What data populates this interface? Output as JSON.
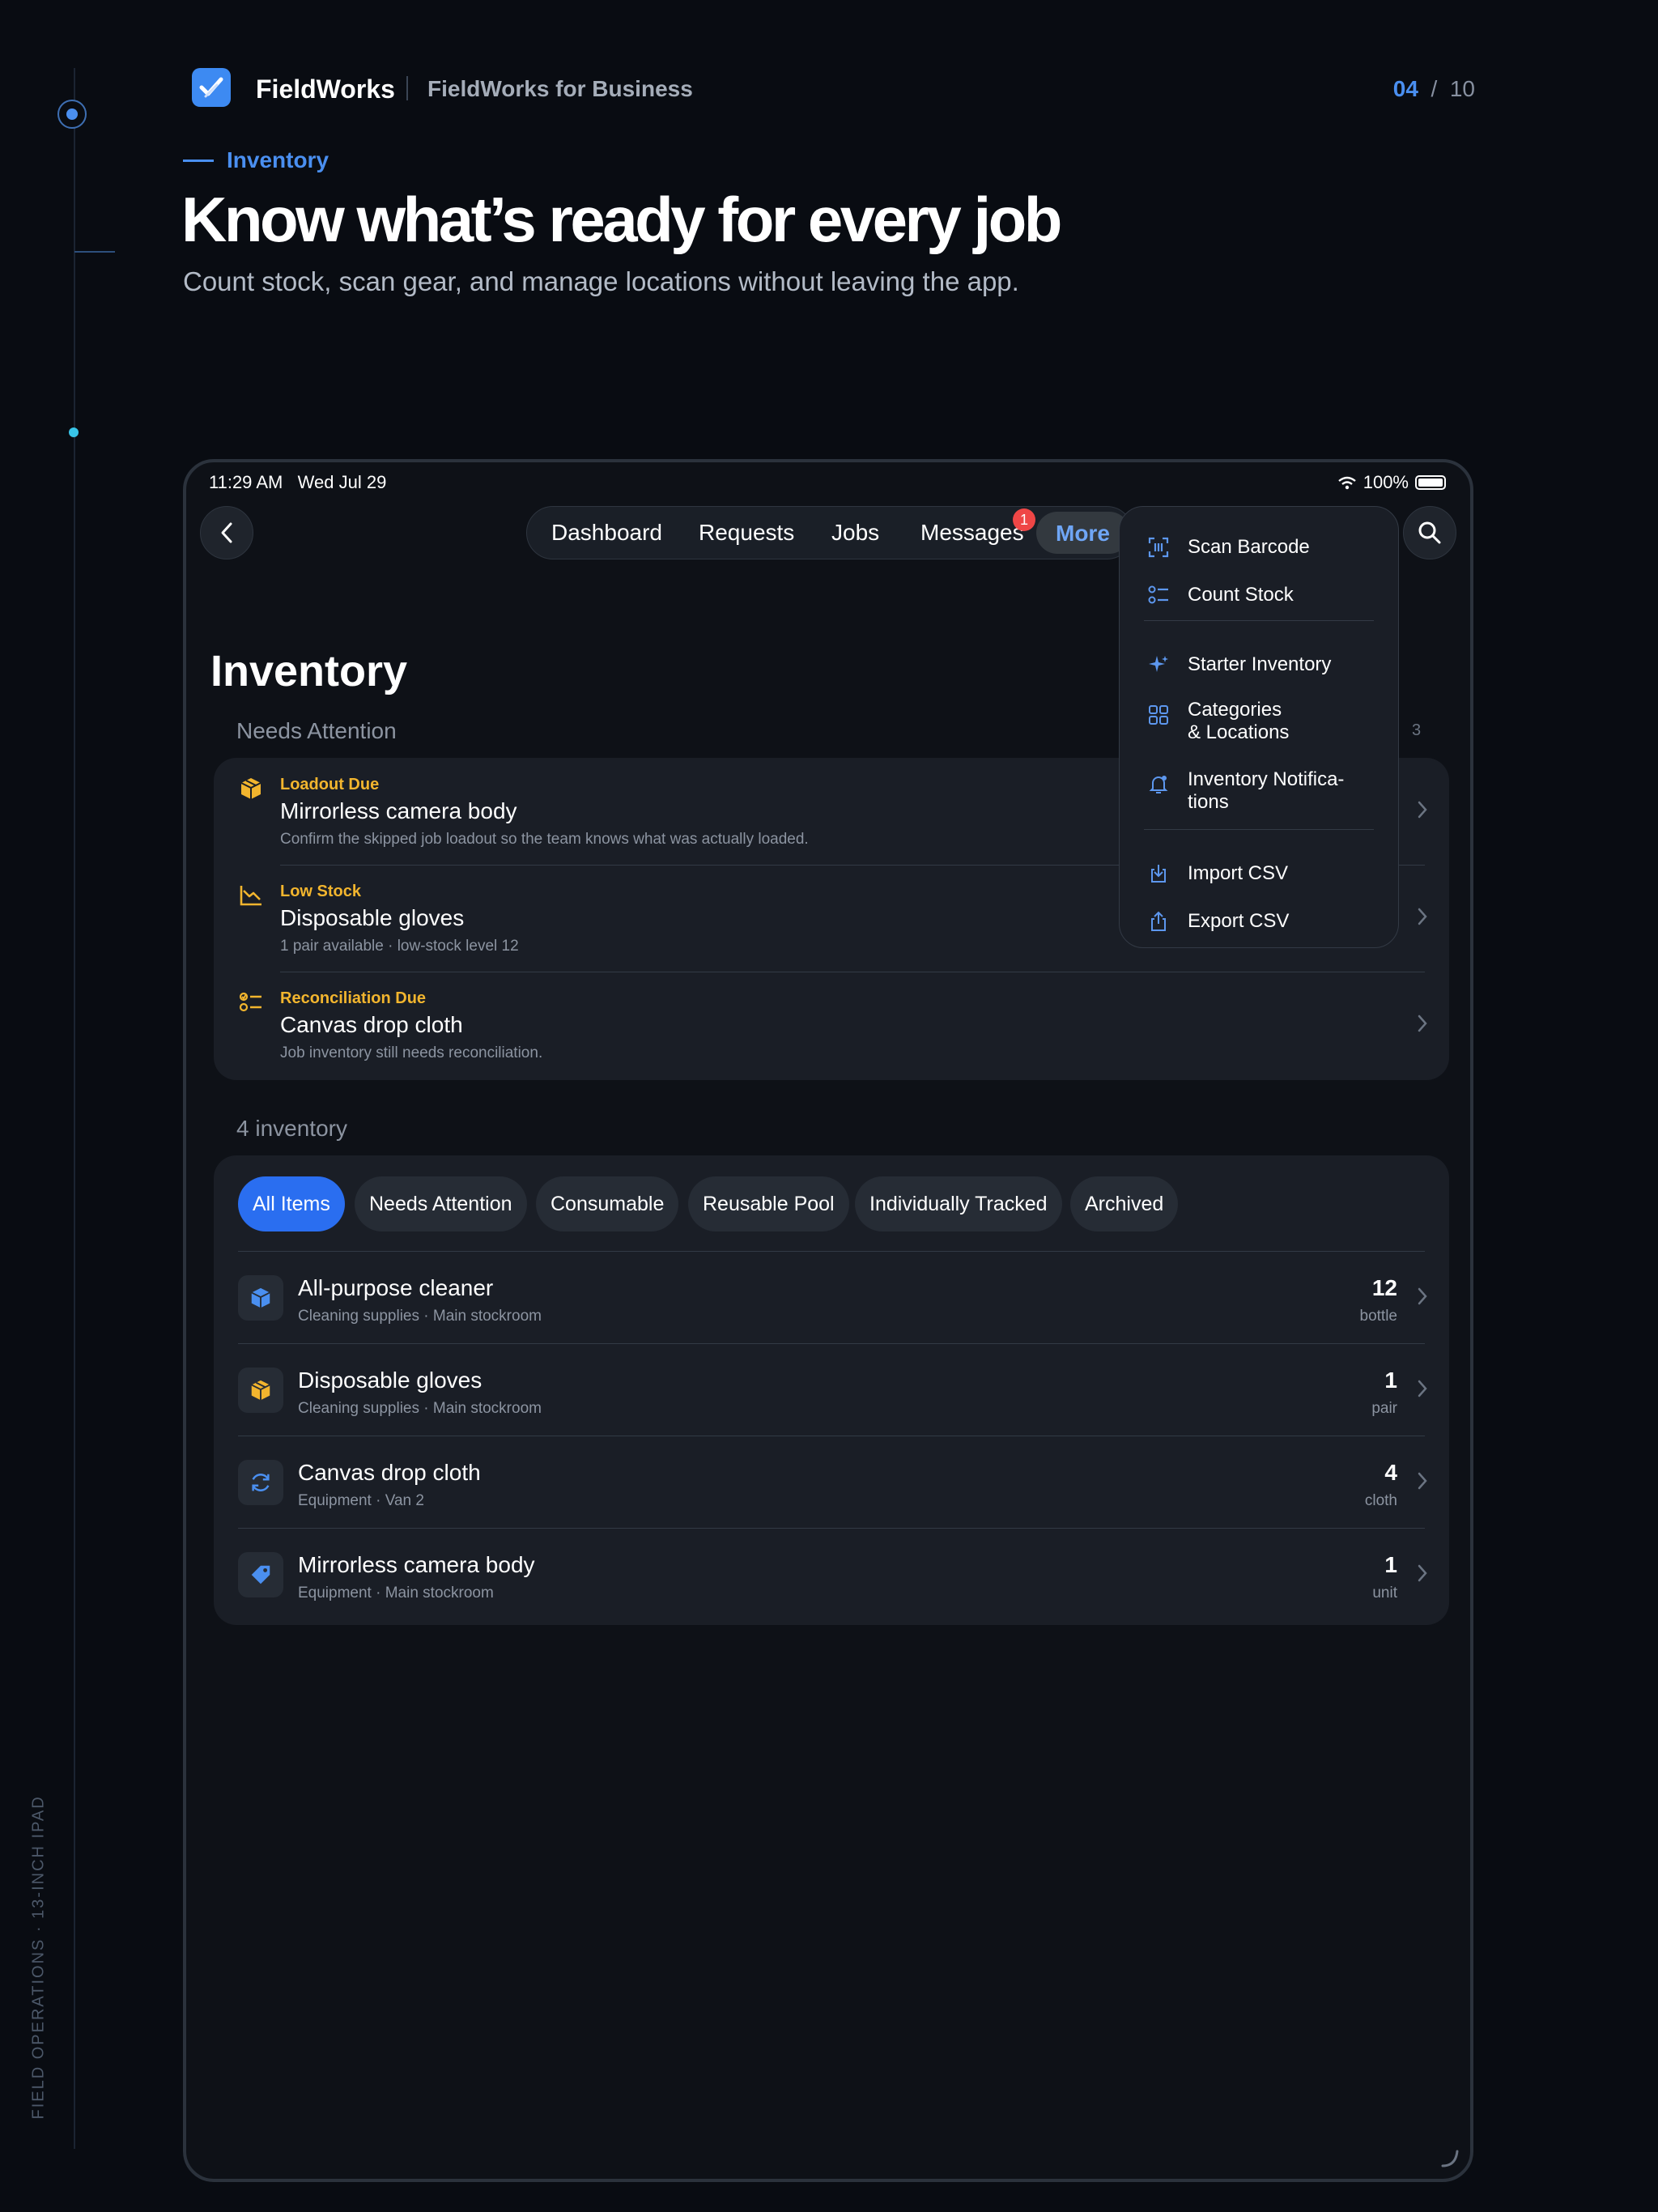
{
  "rail": {
    "caption": "FIELD OPERATIONS · 13-INCH IPAD"
  },
  "brand": {
    "name": "FieldWorks",
    "subtitle": "FieldWorks for Business",
    "accent": "#4a8ff0"
  },
  "pager": {
    "current": "04",
    "separator": "/",
    "total": "10"
  },
  "hero": {
    "eyebrow": "Inventory",
    "headline": "Know what’s ready for every job",
    "subhead": "Count stock, scan gear, and manage locations without leaving the app."
  },
  "status_bar": {
    "time": "11:29 AM",
    "date": "Wed Jul 29",
    "battery": "100%"
  },
  "nav": {
    "items": [
      "Dashboard",
      "Requests",
      "Jobs",
      "Messages"
    ],
    "messages_badge": "1",
    "more_label": "More"
  },
  "page": {
    "title": "Inventory"
  },
  "attention": {
    "label": "Needs Attention",
    "count": "3",
    "items": [
      {
        "tag": "Loadout Due",
        "title": "Mirrorless camera body",
        "desc": "Confirm the skipped job loadout so the team knows what was actually loaded.",
        "icon": "package-icon"
      },
      {
        "tag": "Low Stock",
        "title": "Disposable gloves",
        "desc": "1 pair available · low-stock level 12",
        "icon": "trend-down-icon"
      },
      {
        "tag": "Reconciliation Due",
        "title": "Canvas drop cloth",
        "desc": "Job inventory still needs reconciliation.",
        "icon": "checklist-icon"
      }
    ]
  },
  "inventory": {
    "label": "4 inventory",
    "filters": [
      "All Items",
      "Needs Attention",
      "Consumable",
      "Reusable Pool",
      "Individually Tracked",
      "Archived"
    ],
    "items": [
      {
        "name": "All-purpose cleaner",
        "sub": "Cleaning supplies · Main stockroom",
        "qty": "12",
        "unit": "bottle",
        "icon": "cube-icon"
      },
      {
        "name": "Disposable gloves",
        "sub": "Cleaning supplies · Main stockroom",
        "qty": "1",
        "unit": "pair",
        "icon": "package-icon"
      },
      {
        "name": "Canvas drop cloth",
        "sub": "Equipment · Van 2",
        "qty": "4",
        "unit": "cloth",
        "icon": "refresh-icon"
      },
      {
        "name": "Mirrorless camera body",
        "sub": "Equipment · Main stockroom",
        "qty": "1",
        "unit": "unit",
        "icon": "tag-icon"
      }
    ]
  },
  "more_menu": {
    "items": [
      {
        "label": "Scan Barcode",
        "icon": "barcode-scan-icon"
      },
      {
        "label": "Count Stock",
        "icon": "checklist-icon"
      },
      {
        "label": "Starter Inventory",
        "icon": "sparkle-icon"
      },
      {
        "label": "Categories\n& Locations",
        "icon": "grid-icon"
      },
      {
        "label": "Inventory Notifica-\ntions",
        "icon": "bell-icon"
      },
      {
        "label": "Import CSV",
        "icon": "import-icon"
      },
      {
        "label": "Export CSV",
        "icon": "export-icon"
      }
    ]
  },
  "colors": {
    "warning": "#f2b52e",
    "badge": "#ef4646",
    "chip_active": "#2a6ef0"
  }
}
